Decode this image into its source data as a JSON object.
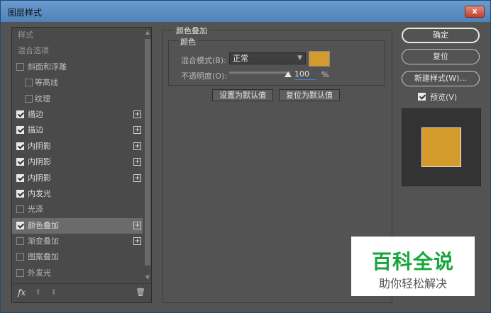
{
  "window": {
    "title": "图层样式",
    "close_label": "x"
  },
  "left_list": {
    "header": "样式",
    "items": [
      {
        "label": "混合选项",
        "type": "header"
      },
      {
        "label": "斜面和浮雕",
        "checked": false,
        "plus": false
      },
      {
        "label": "等高线",
        "checked": false,
        "plus": false,
        "indent": true
      },
      {
        "label": "纹理",
        "checked": false,
        "plus": false,
        "indent": true
      },
      {
        "label": "描边",
        "checked": true,
        "plus": true
      },
      {
        "label": "描边",
        "checked": true,
        "plus": true
      },
      {
        "label": "内阴影",
        "checked": true,
        "plus": true
      },
      {
        "label": "内阴影",
        "checked": true,
        "plus": true
      },
      {
        "label": "内阴影",
        "checked": true,
        "plus": true
      },
      {
        "label": "内发光",
        "checked": true,
        "plus": false
      },
      {
        "label": "光泽",
        "checked": false,
        "plus": false
      },
      {
        "label": "颜色叠加",
        "checked": true,
        "plus": true,
        "selected": true
      },
      {
        "label": "渐变叠加",
        "checked": false,
        "plus": true
      },
      {
        "label": "图案叠加",
        "checked": false,
        "plus": false
      },
      {
        "label": "外发光",
        "checked": false,
        "plus": false
      }
    ],
    "footer": {
      "fx_label": "fx"
    }
  },
  "color_overlay": {
    "group_title": "颜色叠加",
    "sub_title": "颜色",
    "blend_mode_label": "混合模式(B):",
    "blend_mode_value": "正常",
    "color": "#d49a2c",
    "opacity_label": "不透明度(O):",
    "opacity_value": "100",
    "opacity_unit": "%",
    "set_default_label": "设置为默认值",
    "reset_default_label": "复位为默认值"
  },
  "right": {
    "ok_label": "确定",
    "reset_label": "复位",
    "new_style_label": "新建样式(W)...",
    "preview_label": "预览(V)",
    "preview_checked": true,
    "preview_color": "#d49a2c"
  },
  "watermark": {
    "line1": "百科全说",
    "line2": "助你轻松解决"
  }
}
